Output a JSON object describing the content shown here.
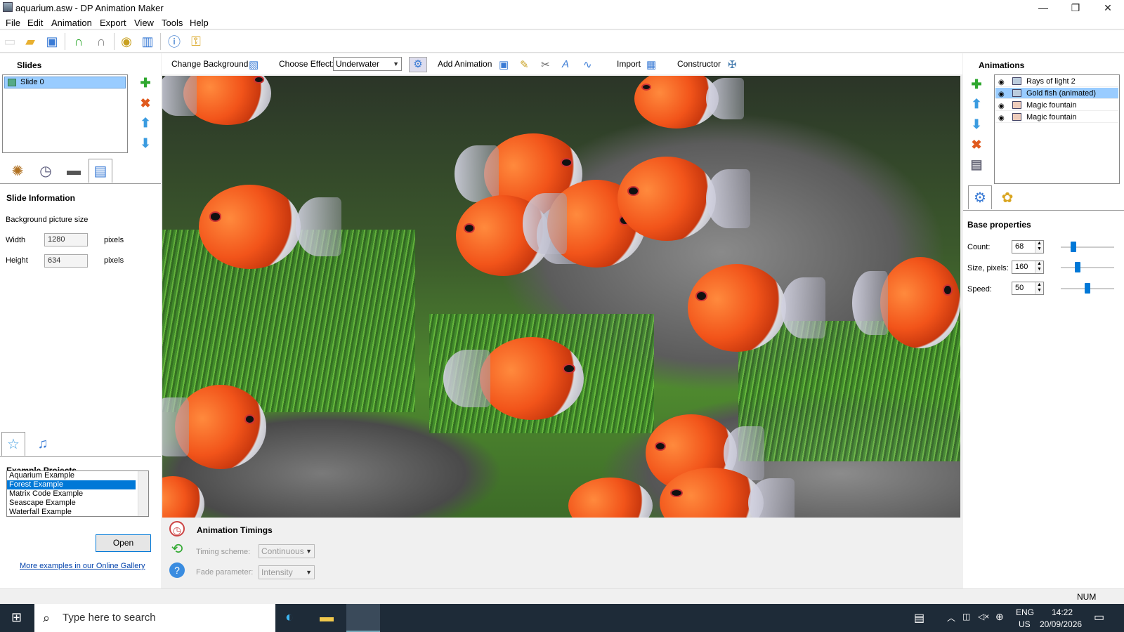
{
  "window": {
    "title": "aquarium.asw - DP Animation Maker",
    "minimize": "—",
    "restore": "❐",
    "close": "✕"
  },
  "menu": [
    "File",
    "Edit",
    "Animation",
    "Export",
    "View",
    "Tools",
    "Help"
  ],
  "left_panel": {
    "slides_title": "Slides",
    "slides": [
      "Slide 0"
    ],
    "slide_info_title": "Slide Information",
    "bg_size_label": "Background picture size",
    "width_label": "Width",
    "width_value": "1280",
    "height_label": "Height",
    "height_value": "634",
    "pixels_unit": "pixels",
    "examples_title": "Example Projects",
    "examples": [
      "Aquarium Example",
      "Forest Example",
      "Matrix Code Example",
      "Seascape Example",
      "Waterfall Example"
    ],
    "examples_selected": "Forest Example",
    "open_button": "Open",
    "gallery_link": "More examples in our Online Gallery"
  },
  "center_toolbar": {
    "change_background": "Change Background",
    "choose_effect_label": "Choose Effect:",
    "effect_value": "Underwater",
    "add_animation": "Add Animation",
    "import": "Import",
    "constructor": "Constructor"
  },
  "timings": {
    "title": "Animation Timings",
    "scheme_label": "Timing scheme:",
    "scheme_value": "Continuous",
    "fade_label": "Fade parameter:",
    "fade_value": "Intensity"
  },
  "right_panel": {
    "animations_title": "Animations",
    "animations": [
      "Rays of light 2",
      "Gold fish (animated)",
      "Magic fountain",
      "Magic fountain"
    ],
    "selected_animation": "Gold fish (animated)",
    "base_props_title": "Base properties",
    "count_label": "Count:",
    "count_value": "68",
    "count_level": 0.2,
    "size_label": "Size, pixels:",
    "size_value": "160",
    "size_level": 0.3,
    "speed_label": "Speed:",
    "speed_value": "50",
    "speed_level": 0.5
  },
  "status": {
    "num": "NUM"
  },
  "taskbar": {
    "search_placeholder": "Type here to search",
    "lang": "ENG",
    "region": "US",
    "time": "14:22",
    "date": "20/09/2026"
  },
  "colors": {
    "accent": "#0078d7",
    "selection": "#99ccff",
    "taskbar": "#1e2b38"
  }
}
